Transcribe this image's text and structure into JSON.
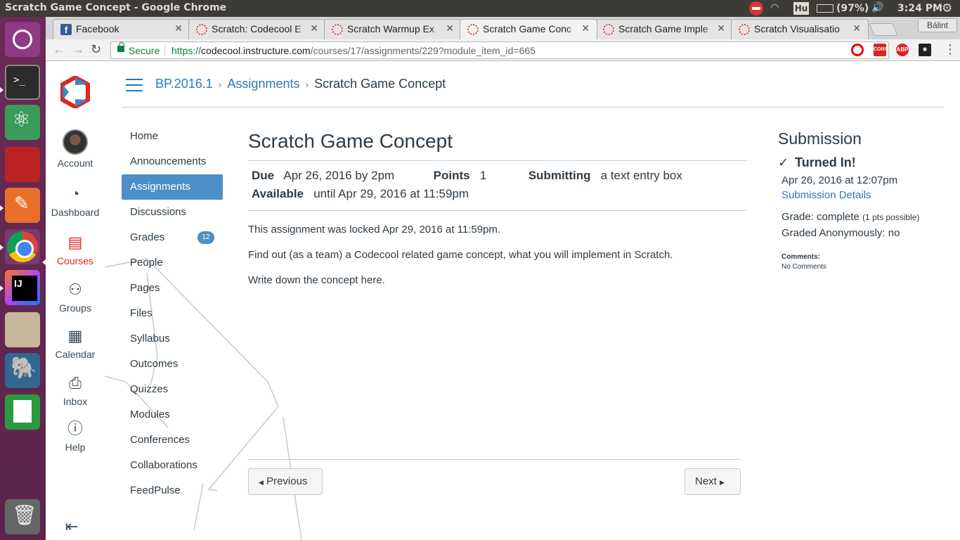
{
  "window": {
    "title": "Scratch Game Concept - Google Chrome",
    "keyboard": "Hu",
    "battery": "(97%)",
    "clock": "3:24 PM"
  },
  "tabs": [
    {
      "label": "Facebook"
    },
    {
      "label": "Scratch: Codecool E"
    },
    {
      "label": "Scratch Warmup Ex"
    },
    {
      "label": "Scratch Game Conc"
    },
    {
      "label": "Scratch Game Imple"
    },
    {
      "label": "Scratch Visualisatio"
    }
  ],
  "profile_name": "Bálint",
  "addressbar": {
    "secure": "Secure",
    "scheme": "https://",
    "host": "codecool.instructure.com",
    "path": "/courses/17/assignments/229?module_item_id=665",
    "ext_cors": "CORS",
    "ext_abp": "ABP"
  },
  "globalnav": {
    "account": "Account",
    "dashboard": "Dashboard",
    "courses": "Courses",
    "groups": "Groups",
    "calendar": "Calendar",
    "inbox": "Inbox",
    "help": "Help"
  },
  "breadcrumbs": {
    "course": "BP.2016.1",
    "section": "Assignments",
    "current": "Scratch Game Concept"
  },
  "coursenav": [
    {
      "label": "Home"
    },
    {
      "label": "Announcements"
    },
    {
      "label": "Assignments"
    },
    {
      "label": "Discussions"
    },
    {
      "label": "Grades",
      "badge": "12"
    },
    {
      "label": "People"
    },
    {
      "label": "Pages"
    },
    {
      "label": "Files"
    },
    {
      "label": "Syllabus"
    },
    {
      "label": "Outcomes"
    },
    {
      "label": "Quizzes"
    },
    {
      "label": "Modules"
    },
    {
      "label": "Conferences"
    },
    {
      "label": "Collaborations"
    },
    {
      "label": "FeedPulse"
    }
  ],
  "assignment": {
    "title": "Scratch Game Concept",
    "due_label": "Due",
    "due_value": "Apr 26, 2016 by 2pm",
    "points_label": "Points",
    "points_value": "1",
    "submitting_label": "Submitting",
    "submitting_value": "a text entry box",
    "available_label": "Available",
    "available_value": "until Apr 29, 2016 at 11:59pm",
    "locked_note": "This assignment was locked Apr 29, 2016 at 11:59pm.",
    "desc1": "Find out (as a team) a Codecool related game concept, what you will implement in Scratch.",
    "desc2": "Write down the concept here."
  },
  "pager": {
    "previous": "Previous",
    "next": "Next"
  },
  "submission": {
    "heading": "Submission",
    "status": "Turned In!",
    "date": "Apr 26, 2016 at 12:07pm",
    "details_link": "Submission Details",
    "grade_label": "Grade: complete",
    "grade_possible": "(1 pts possible)",
    "anonymous": "Graded Anonymously: no",
    "comments_label": "Comments:",
    "comments_value": "No Comments"
  },
  "colors": {
    "accent": "#2a7abc",
    "active_nav": "#4b8fc8",
    "courses_active": "#e1261c",
    "secure_green": "#0b8043"
  }
}
